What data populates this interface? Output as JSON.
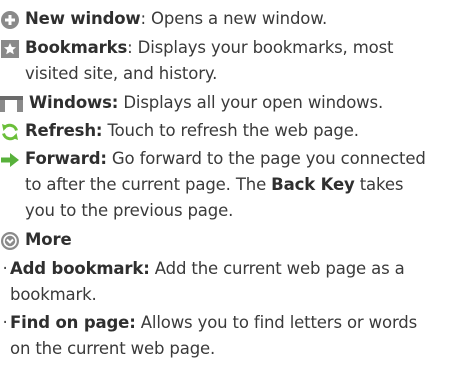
{
  "items": [
    {
      "icon": "new-window-icon",
      "label": "New window",
      "sep": ": ",
      "desc_line1": "Opens a new window."
    },
    {
      "icon": "bookmarks-icon",
      "label": "Bookmarks",
      "sep": ": ",
      "desc_line1": "Displays your bookmarks, most",
      "desc_line2": "visited site, and history."
    },
    {
      "icon": "windows-icon",
      "label": "Windows:",
      "sep": " ",
      "desc_line1": "Displays all your open windows."
    },
    {
      "icon": "refresh-icon",
      "label": "Refresh:",
      "sep": " ",
      "desc_line1": "Touch to refresh the web page."
    },
    {
      "icon": "forward-icon",
      "label": "Forward:",
      "sep": " ",
      "desc_line1": "Go forward to the page you connected",
      "desc_line2": "to after the current page. The ",
      "desc_bold": "Back Key",
      "desc_line2_end": " takes",
      "desc_line3": "you to the previous page."
    },
    {
      "icon": "more-icon",
      "label": "More"
    }
  ],
  "bullets": [
    {
      "marker": "·",
      "label": "Add bookmark:",
      "desc_line1": " Add the current web page as a",
      "desc_line2": "bookmark."
    },
    {
      "marker": "·",
      "label": "Find on page:",
      "desc_line1": " Allows you to find letters or words",
      "desc_line2": "on the current web page."
    }
  ],
  "colors": {
    "icon_gray": "#8a8a8a",
    "icon_dark": "#666666",
    "refresh_green": "#6bbf3a",
    "forward_green": "#58b13b",
    "text": "#3a3a3a"
  }
}
